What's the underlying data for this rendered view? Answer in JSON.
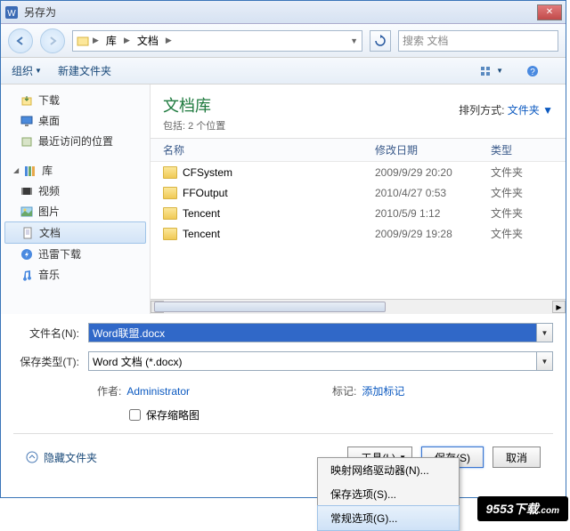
{
  "titlebar": {
    "title": "另存为"
  },
  "nav": {
    "path": [
      "库",
      "文档"
    ],
    "search_placeholder": "搜索 文档"
  },
  "toolbar": {
    "organize": "组织",
    "newfolder": "新建文件夹"
  },
  "sidebar": {
    "downloads": "下载",
    "desktop": "桌面",
    "recent": "最近访问的位置",
    "library": "库",
    "videos": "视频",
    "pictures": "图片",
    "documents": "文档",
    "thunder": "迅雷下载",
    "music": "音乐"
  },
  "main": {
    "lib_title": "文档库",
    "lib_sub": "包括: 2 个位置",
    "arrange_label": "排列方式:",
    "arrange_value": "文件夹",
    "cols": {
      "name": "名称",
      "date": "修改日期",
      "type": "类型"
    },
    "rows": [
      {
        "name": "CFSystem",
        "date": "2009/9/29 20:20",
        "type": "文件夹"
      },
      {
        "name": "FFOutput",
        "date": "2010/4/27 0:53",
        "type": "文件夹"
      },
      {
        "name": "Tencent",
        "date": "2010/5/9 1:12",
        "type": "文件夹"
      },
      {
        "name": "Tencent",
        "date": "2009/9/29 19:28",
        "type": "文件夹"
      }
    ]
  },
  "fields": {
    "filename_label": "文件名(N):",
    "filename_value": "Word联盟.docx",
    "filetype_label": "保存类型(T):",
    "filetype_value": "Word 文档 (*.docx)",
    "author_label": "作者:",
    "author_value": "Administrator",
    "tags_label": "标记:",
    "tags_value": "添加标记",
    "thumbnail": "保存缩略图"
  },
  "footer": {
    "hide": "隐藏文件夹",
    "tools": "工具(L)",
    "save": "保存(S)",
    "cancel": "取消"
  },
  "menu": {
    "items": [
      "映射网络驱动器(N)...",
      "保存选项(S)...",
      "常规选项(G)..."
    ]
  },
  "watermark": {
    "text": "9553",
    "suffix": "下载",
    "com": ".com"
  }
}
